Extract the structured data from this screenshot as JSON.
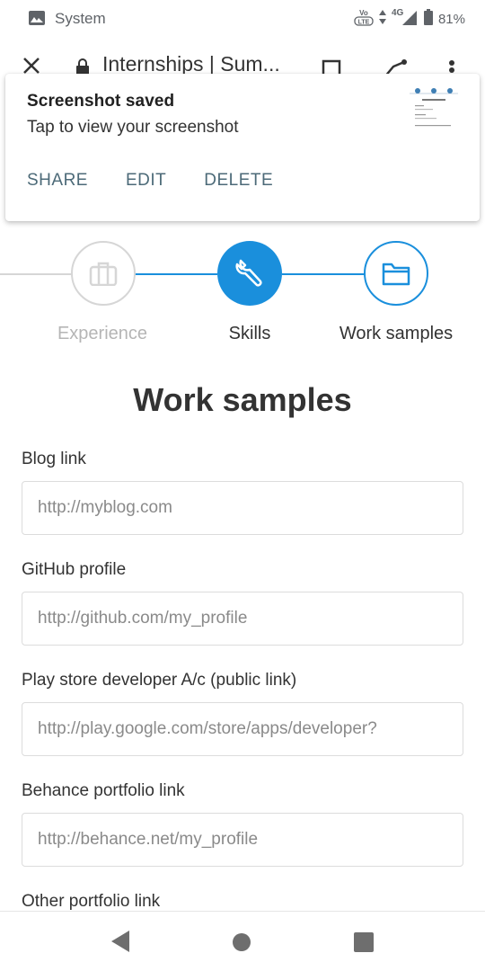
{
  "status_bar": {
    "app_name": "System",
    "volte": "VoLTE",
    "network": "4G",
    "battery": "81%"
  },
  "browser": {
    "tab_title": "Internships | Sum..."
  },
  "notification": {
    "title": "Screenshot saved",
    "text": "Tap to view your screenshot",
    "actions": [
      "SHARE",
      "EDIT",
      "DELETE"
    ]
  },
  "stepper": {
    "steps": [
      {
        "label": "Experience",
        "state": "inactive",
        "icon": "briefcase-icon"
      },
      {
        "label": "Skills",
        "state": "completed",
        "icon": "wrench-icon"
      },
      {
        "label": "Work samples",
        "state": "current",
        "icon": "folder-icon"
      }
    ]
  },
  "form": {
    "title": "Work samples",
    "fields": [
      {
        "label": "Blog link",
        "placeholder": "http://myblog.com",
        "value": ""
      },
      {
        "label": "GitHub profile",
        "placeholder": "http://github.com/my_profile",
        "value": ""
      },
      {
        "label": "Play store developer A/c (public link)",
        "placeholder": "http://play.google.com/store/apps/developer?",
        "value": ""
      },
      {
        "label": "Behance portfolio link",
        "placeholder": "http://behance.net/my_profile",
        "value": ""
      },
      {
        "label": "Other portfolio link",
        "placeholder": "",
        "value": ""
      }
    ]
  },
  "colors": {
    "accent": "#1a8fdc",
    "inactive": "#d6d6d6",
    "notification_action": "#4c6a78"
  },
  "nav": {
    "icons": [
      "back-icon",
      "home-icon",
      "recents-icon"
    ]
  }
}
